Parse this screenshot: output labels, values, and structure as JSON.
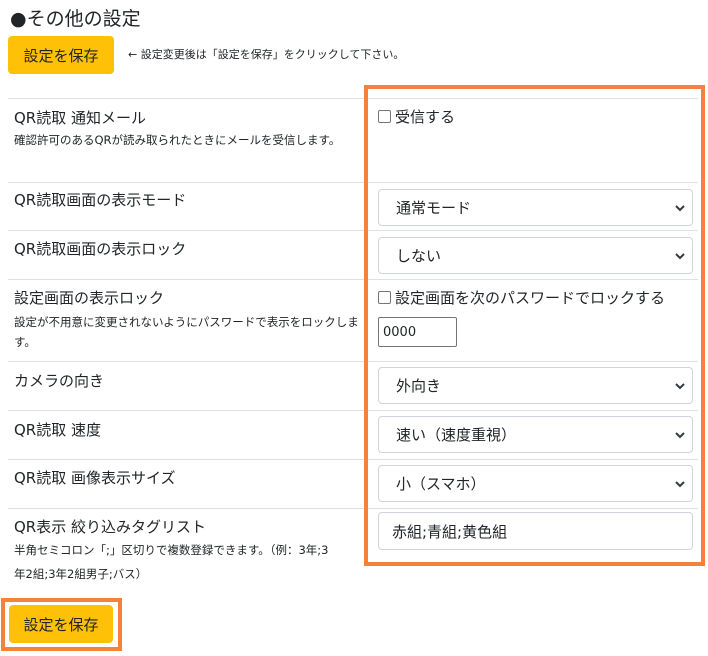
{
  "page": {
    "title": "●その他の設定",
    "save_label": "設定を保存",
    "note": "← 設定変更後は「設定を保存」をクリックして下さい。"
  },
  "settings": {
    "qr_notify": {
      "label": "QR読取 通知メール",
      "desc": "確認許可のあるQRが読み取られたときにメールを受信します。",
      "checkbox_label": "受信する"
    },
    "display_mode": {
      "label": "QR読取画面の表示モード",
      "selected": "通常モード"
    },
    "display_lock": {
      "label": "QR読取画面の表示ロック",
      "selected": "しない"
    },
    "settings_lock": {
      "label": "設定画面の表示ロック",
      "desc": "設定が不用意に変更されないようにパスワードで表示をロックします。",
      "checkbox_label": "設定画面を次のパスワードでロックする",
      "password": "0000"
    },
    "camera": {
      "label": "カメラの向き",
      "selected": "外向き"
    },
    "speed": {
      "label": "QR読取 速度",
      "selected": "速い（速度重視）"
    },
    "image_size": {
      "label": "QR読取 画像表示サイズ",
      "selected": "小（スマホ）"
    },
    "tag_list": {
      "label": "QR表示 絞り込みタグリスト",
      "desc_line1": "半角セミコロン「;」区切りで複数登録できます。（例：3年;3",
      "desc_line2": "年2組;3年2組男子;バス）",
      "value": "赤組;青組;黄色組"
    }
  },
  "colors": {
    "save_button": "#ffc107",
    "highlight": "#f5823a",
    "divider": "#dee2e6"
  }
}
